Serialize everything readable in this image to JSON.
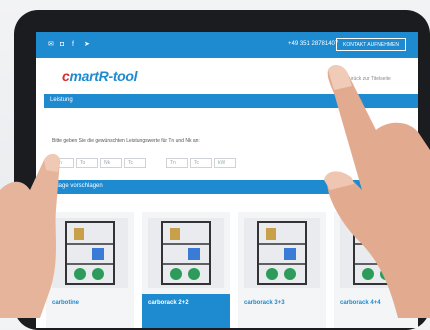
{
  "topbar": {
    "social_icons": [
      "mail-icon",
      "instagram-icon",
      "facebook-icon",
      "telegram-icon"
    ],
    "phone": "+49 351 28781407",
    "contact_button": "KONTAKT AUFNEHMEN"
  },
  "logo": {
    "prefix": "c",
    "rest": "martR-tool"
  },
  "tagline": "Zurück zur Titelseite",
  "section1": {
    "title": "Leistung"
  },
  "instruction": "Bitte geben Sie die gewünschten Leistungswerte für Tn und Nk an:",
  "fields": [
    "Tn",
    "To",
    "Nk",
    "Tc",
    "Tn",
    "Tc",
    "kW"
  ],
  "section2": {
    "title": "Anlage vorschlagen"
  },
  "products": [
    {
      "name": "carbotine"
    },
    {
      "name": "carborack 2+2"
    },
    {
      "name": "carborack 3+3"
    },
    {
      "name": "carborack 4+4"
    }
  ],
  "colors": {
    "accent": "#1e8ad0",
    "logo_red": "#d63030",
    "frame": "#1b1c1f"
  }
}
